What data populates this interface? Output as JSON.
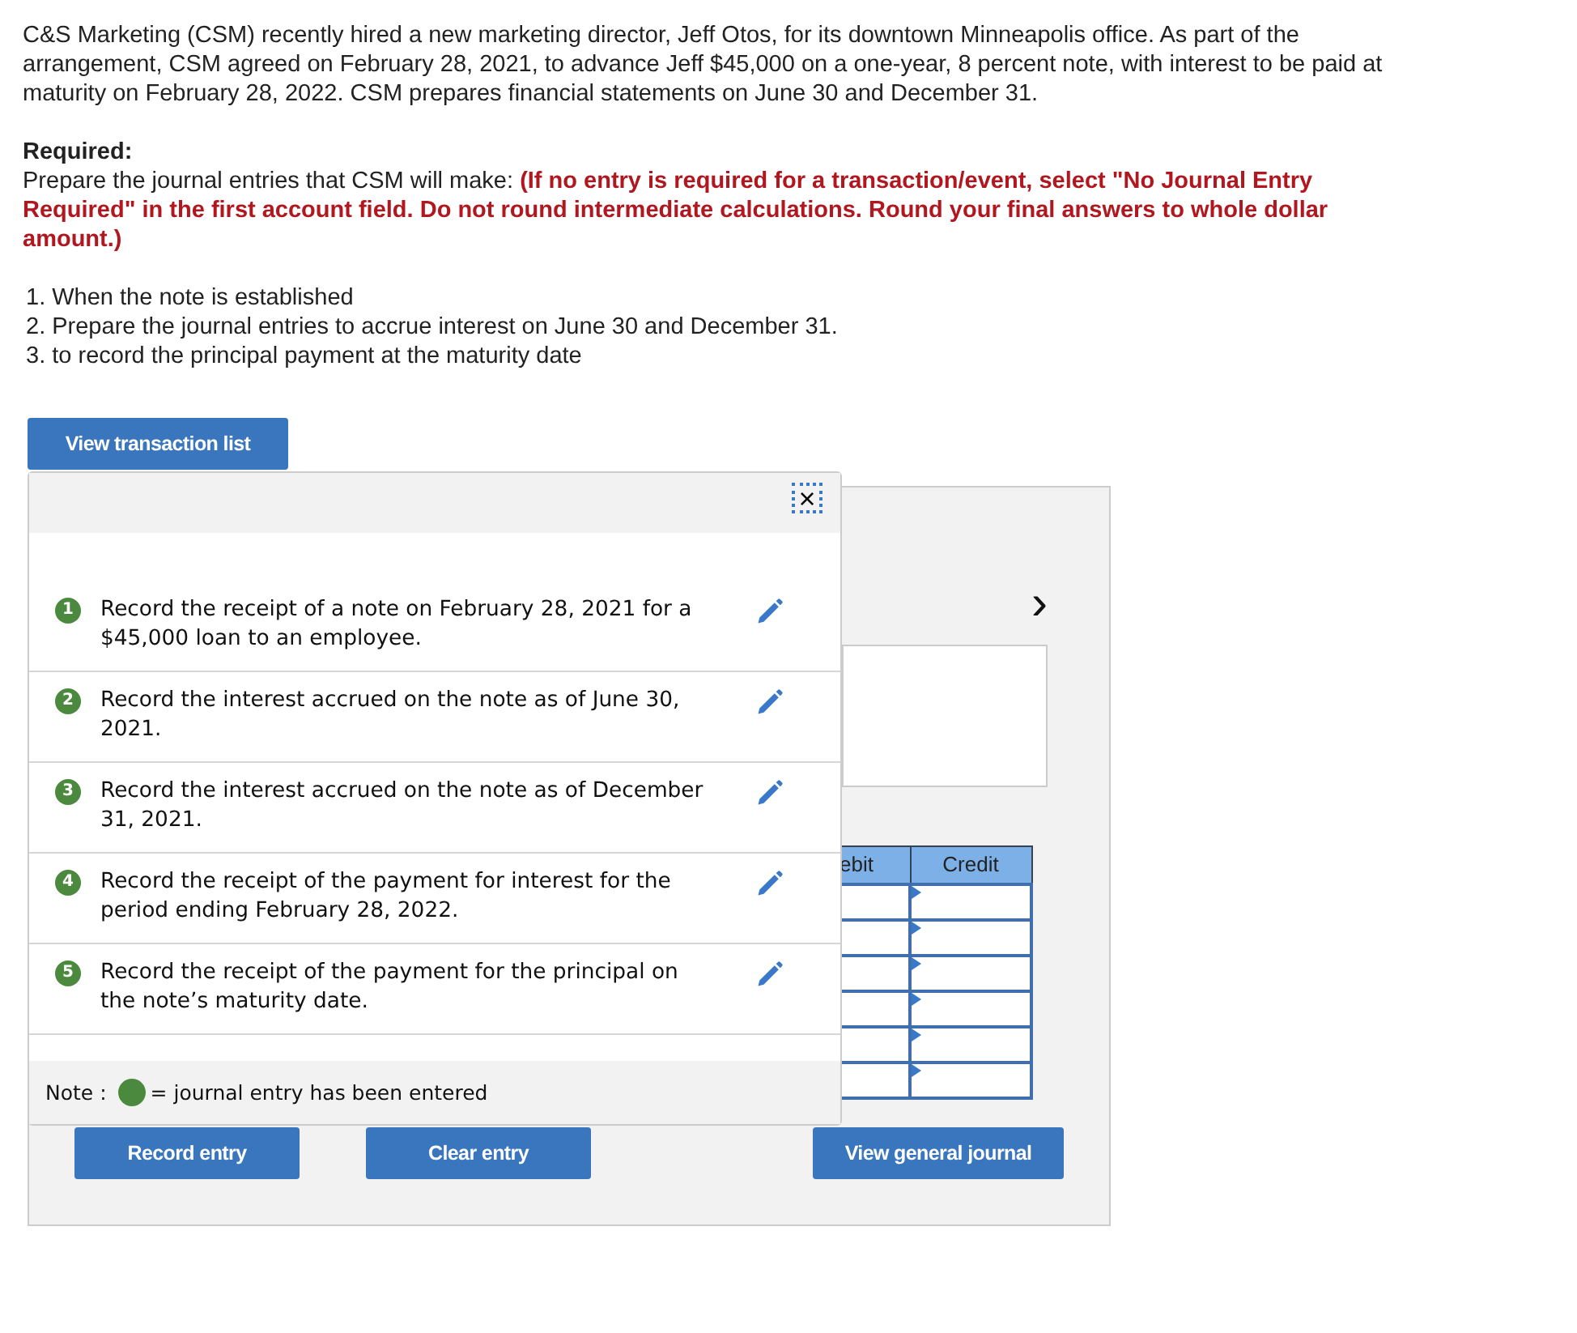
{
  "problem": {
    "intro": "C&S Marketing (CSM) recently hired a new marketing director, Jeff Otos, for its downtown Minneapolis office. As part of the arrangement, CSM agreed on February 28, 2021, to advance Jeff $45,000 on a one-year, 8 percent note, with interest to be paid at maturity on February 28, 2022. CSM prepares financial statements on June 30 and December 31.",
    "required_label": "Required:",
    "instruction": "Prepare the journal entries that CSM will make: **(If no entry is required for a transaction/event, select \"No Journal Entry Required\" in the first account field. Do not round intermediate calculations. Round your final answers to whole dollar amount.)**",
    "steps": [
      "1. When the note is established",
      "2. Prepare the journal entries to accrue interest on June 30 and December 31.",
      "3.  to record the principal payment at the maturity date"
    ]
  },
  "view_transaction_button": "View transaction list",
  "transaction_popup": {
    "close": "×",
    "items": [
      {
        "number": "1",
        "text": "Record the receipt of a note on February 28, 2021 for a $45,000 loan to an employee.",
        "entered": true
      },
      {
        "number": "2",
        "text": "Record the interest accrued on the note as of June 30, 2021.",
        "entered": true
      },
      {
        "number": "3",
        "text": "Record the interest accrued on the note as of December 31, 2021.",
        "entered": true
      },
      {
        "number": "4",
        "text": "Record the receipt of the payment for interest for the period ending February 28, 2022.",
        "entered": true
      },
      {
        "number": "5",
        "text": "Record the receipt of the payment for the principal on the note’s maturity date.",
        "entered": true
      }
    ],
    "note_label": "Note :",
    "note_text": "= journal entry has been entered"
  },
  "worksheet": {
    "next": "›",
    "columns": [
      "ebit",
      "Credit"
    ],
    "rows": [
      {
        "kind": "input"
      },
      {
        "kind": "input"
      },
      {
        "kind": "input"
      },
      {
        "kind": "input"
      },
      {
        "kind": "input"
      },
      {
        "kind": "input"
      }
    ],
    "buttons": [
      "Record entry",
      "Clear entry",
      "View general journal"
    ]
  }
}
